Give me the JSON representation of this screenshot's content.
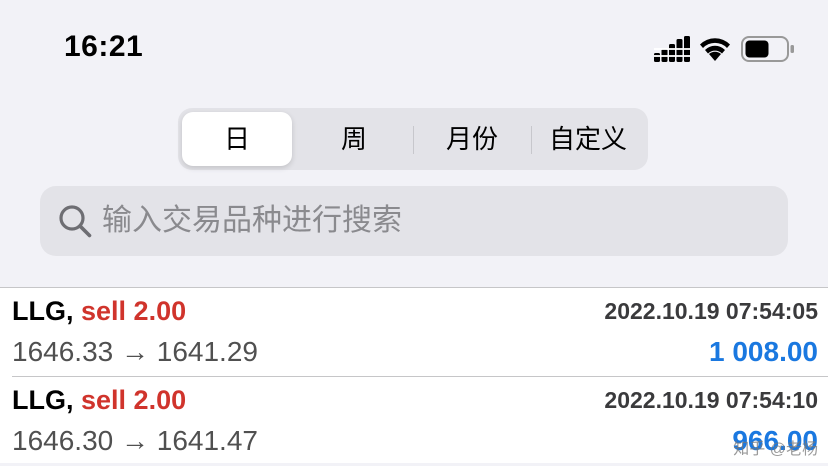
{
  "status_bar": {
    "time": "16:21",
    "icons": [
      "cellular-signal-icon",
      "wifi-icon",
      "battery-icon"
    ]
  },
  "period_tabs": [
    {
      "label": "日",
      "selected": true
    },
    {
      "label": "周",
      "selected": false
    },
    {
      "label": "月份",
      "selected": false
    },
    {
      "label": "自定义",
      "selected": false
    }
  ],
  "search": {
    "placeholder": "输入交易品种进行搜索",
    "icon": "search-icon"
  },
  "trades": [
    {
      "symbol": "LLG,",
      "action": "sell 2.00",
      "datetime": "2022.10.19 07:54:05",
      "prices": "1646.33 → 1641.29",
      "profit": "1 008.00"
    },
    {
      "symbol": "LLG,",
      "action": "sell 2.00",
      "datetime": "2022.10.19 07:54:10",
      "prices": "1646.30 → 1641.47",
      "profit": "966.00"
    }
  ],
  "watermark": "知乎 @老杨",
  "colors": {
    "sell": "#d0342c",
    "profit_positive": "#1a78e0",
    "background": "#f2f2f7"
  }
}
